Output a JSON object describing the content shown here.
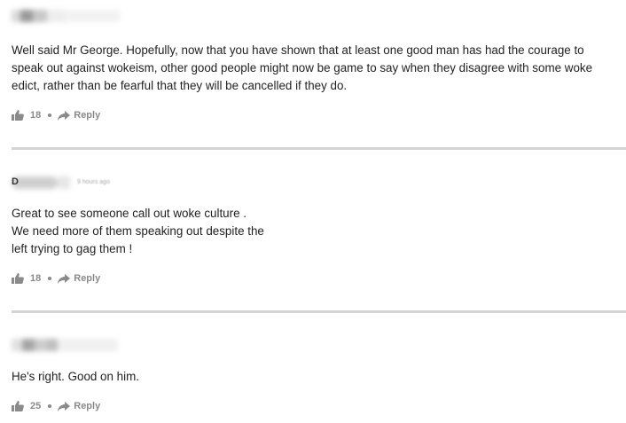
{
  "comments": [
    {
      "author": "",
      "timestamp": "",
      "text": "Well said Mr George. Hopefully, now that you have shown that at least one good man has had the courage to\nspeak out against wokeism, other good people might now be game to say when they disagree with some woke\nedict, rather than be fearful that they will be cancelled if they do.",
      "likes": "18",
      "reply_label": "Reply",
      "icons": {
        "like": "thumbs-up-icon",
        "reply": "reply-arrow-icon"
      }
    },
    {
      "author": "D",
      "timestamp": "9 hours ago",
      "text": "Great to see someone call out woke culture .\nWe need more of them speaking out despite the\nleft trying to gag them !",
      "likes": "18",
      "reply_label": "Reply",
      "icons": {
        "like": "thumbs-up-icon",
        "reply": "reply-arrow-icon"
      }
    },
    {
      "author": "",
      "timestamp": "",
      "text": "He's right. Good on him.",
      "likes": "25",
      "reply_label": "Reply",
      "icons": {
        "like": "thumbs-up-icon",
        "reply": "reply-arrow-icon"
      }
    }
  ],
  "colors": {
    "text": "#222222",
    "meta": "#8a8a8a",
    "divider": "#d4d4d4"
  }
}
